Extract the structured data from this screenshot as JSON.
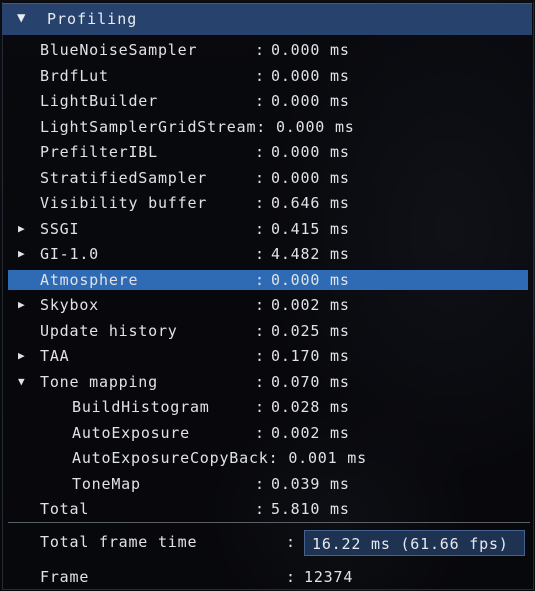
{
  "header": {
    "arrow": "▼",
    "title": "Profiling"
  },
  "rows": [
    {
      "name": "BlueNoiseSampler",
      "value": "0.000 ms"
    },
    {
      "name": "BrdfLut",
      "value": "0.000 ms"
    },
    {
      "name": "LightBuilder",
      "value": "0.000 ms"
    },
    {
      "name": "LightSamplerGridStream",
      "value": "0.000 ms"
    },
    {
      "name": "PrefilterIBL",
      "value": "0.000 ms"
    },
    {
      "name": "StratifiedSampler",
      "value": "0.000 ms"
    },
    {
      "name": "Visibility buffer",
      "value": "0.646 ms"
    },
    {
      "name": "SSGI",
      "value": "0.415 ms",
      "toggle": "▶"
    },
    {
      "name": "GI-1.0",
      "value": "4.482 ms",
      "toggle": "▶"
    },
    {
      "name": "Atmosphere",
      "value": "0.000 ms"
    },
    {
      "name": "Skybox",
      "value": "0.002 ms",
      "toggle": "▶"
    },
    {
      "name": "Update history",
      "value": "0.025 ms"
    },
    {
      "name": "TAA",
      "value": "0.170 ms",
      "toggle": "▶"
    },
    {
      "name": "Tone mapping",
      "value": "0.070 ms",
      "toggle": "▼"
    },
    {
      "name": "BuildHistogram",
      "value": "0.028 ms"
    },
    {
      "name": "AutoExposure",
      "value": "0.002 ms"
    },
    {
      "name": "AutoExposureCopyBack",
      "value": "0.001 ms"
    },
    {
      "name": "ToneMap",
      "value": "0.039 ms"
    },
    {
      "name": "Total",
      "value": "5.810 ms"
    }
  ],
  "colon": ":",
  "footer": {
    "frame_time_label": "Total frame time",
    "frame_time_value": "16.22 ms (61.66 fps)",
    "frame_label": "Frame",
    "frame_value": "12374"
  },
  "colors": {
    "header_bg": "#27426d",
    "selection": "#2f6bb5",
    "text": "#dfe2e6"
  }
}
